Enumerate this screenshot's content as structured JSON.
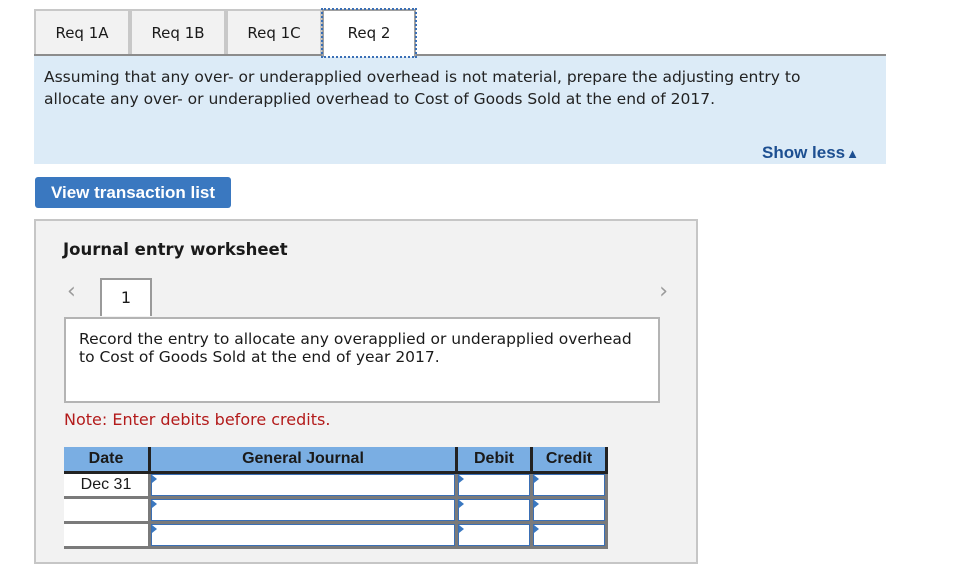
{
  "tabs": [
    {
      "label": "Req 1A",
      "active": false
    },
    {
      "label": "Req 1B",
      "active": false
    },
    {
      "label": "Req 1C",
      "active": false
    },
    {
      "label": "Req 2",
      "active": true
    }
  ],
  "instructions": {
    "text": "Assuming that any over- or underapplied overhead is not material, prepare the adjusting entry to allocate any over- or underapplied overhead to Cost of Goods Sold at the end of 2017.",
    "show_less_label": "Show less",
    "show_less_icon": "▲"
  },
  "view_transaction_list_label": "View transaction list",
  "worksheet": {
    "title": "Journal entry worksheet",
    "prev_icon": "‹",
    "next_icon": "›",
    "current_page": "1",
    "record_text": "Record the entry to allocate any overapplied or underapplied overhead to Cost of Goods Sold at the end of year 2017.",
    "note": "Note: Enter debits before credits.",
    "table": {
      "headers": [
        "Date",
        "General Journal",
        "Debit",
        "Credit"
      ],
      "rows": [
        {
          "date": "Dec 31",
          "account": "",
          "debit": "",
          "credit": ""
        },
        {
          "date": "",
          "account": "",
          "debit": "",
          "credit": ""
        },
        {
          "date": "",
          "account": "",
          "debit": "",
          "credit": ""
        }
      ]
    }
  }
}
